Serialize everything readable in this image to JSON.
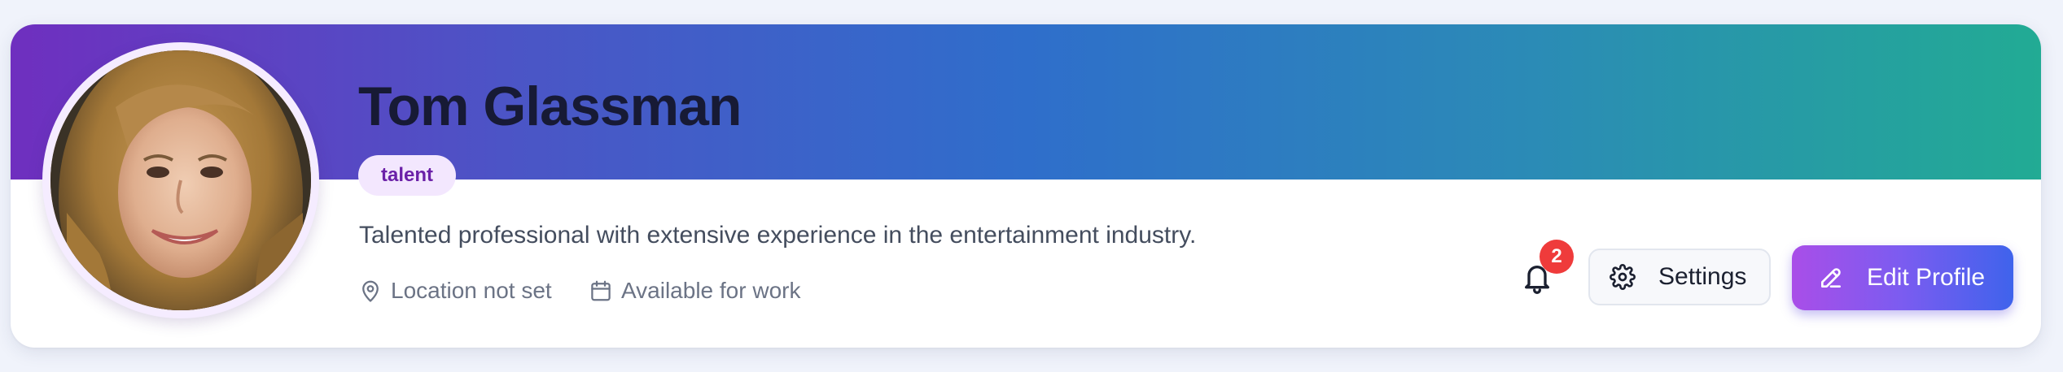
{
  "profile": {
    "name": "Tom Glassman",
    "role": "talent",
    "bio": "Talented professional with extensive experience in the entertainment industry.",
    "location": "Location not set",
    "availability": "Available for work"
  },
  "notifications": {
    "icon": "bell-icon",
    "count": "2"
  },
  "actions": {
    "settings_label": "Settings",
    "settings_icon": "gear-icon",
    "edit_label": "Edit Profile",
    "edit_icon": "pencil-icon"
  },
  "colors": {
    "banner_start": "#6f2fbf",
    "banner_end": "#22ab94",
    "badge_bg": "#f3e7fe",
    "badge_text": "#6b21a8",
    "notification_badge": "#ef3b3b",
    "edit_button_start": "#a94ee8",
    "edit_button_end": "#3f63ec"
  }
}
